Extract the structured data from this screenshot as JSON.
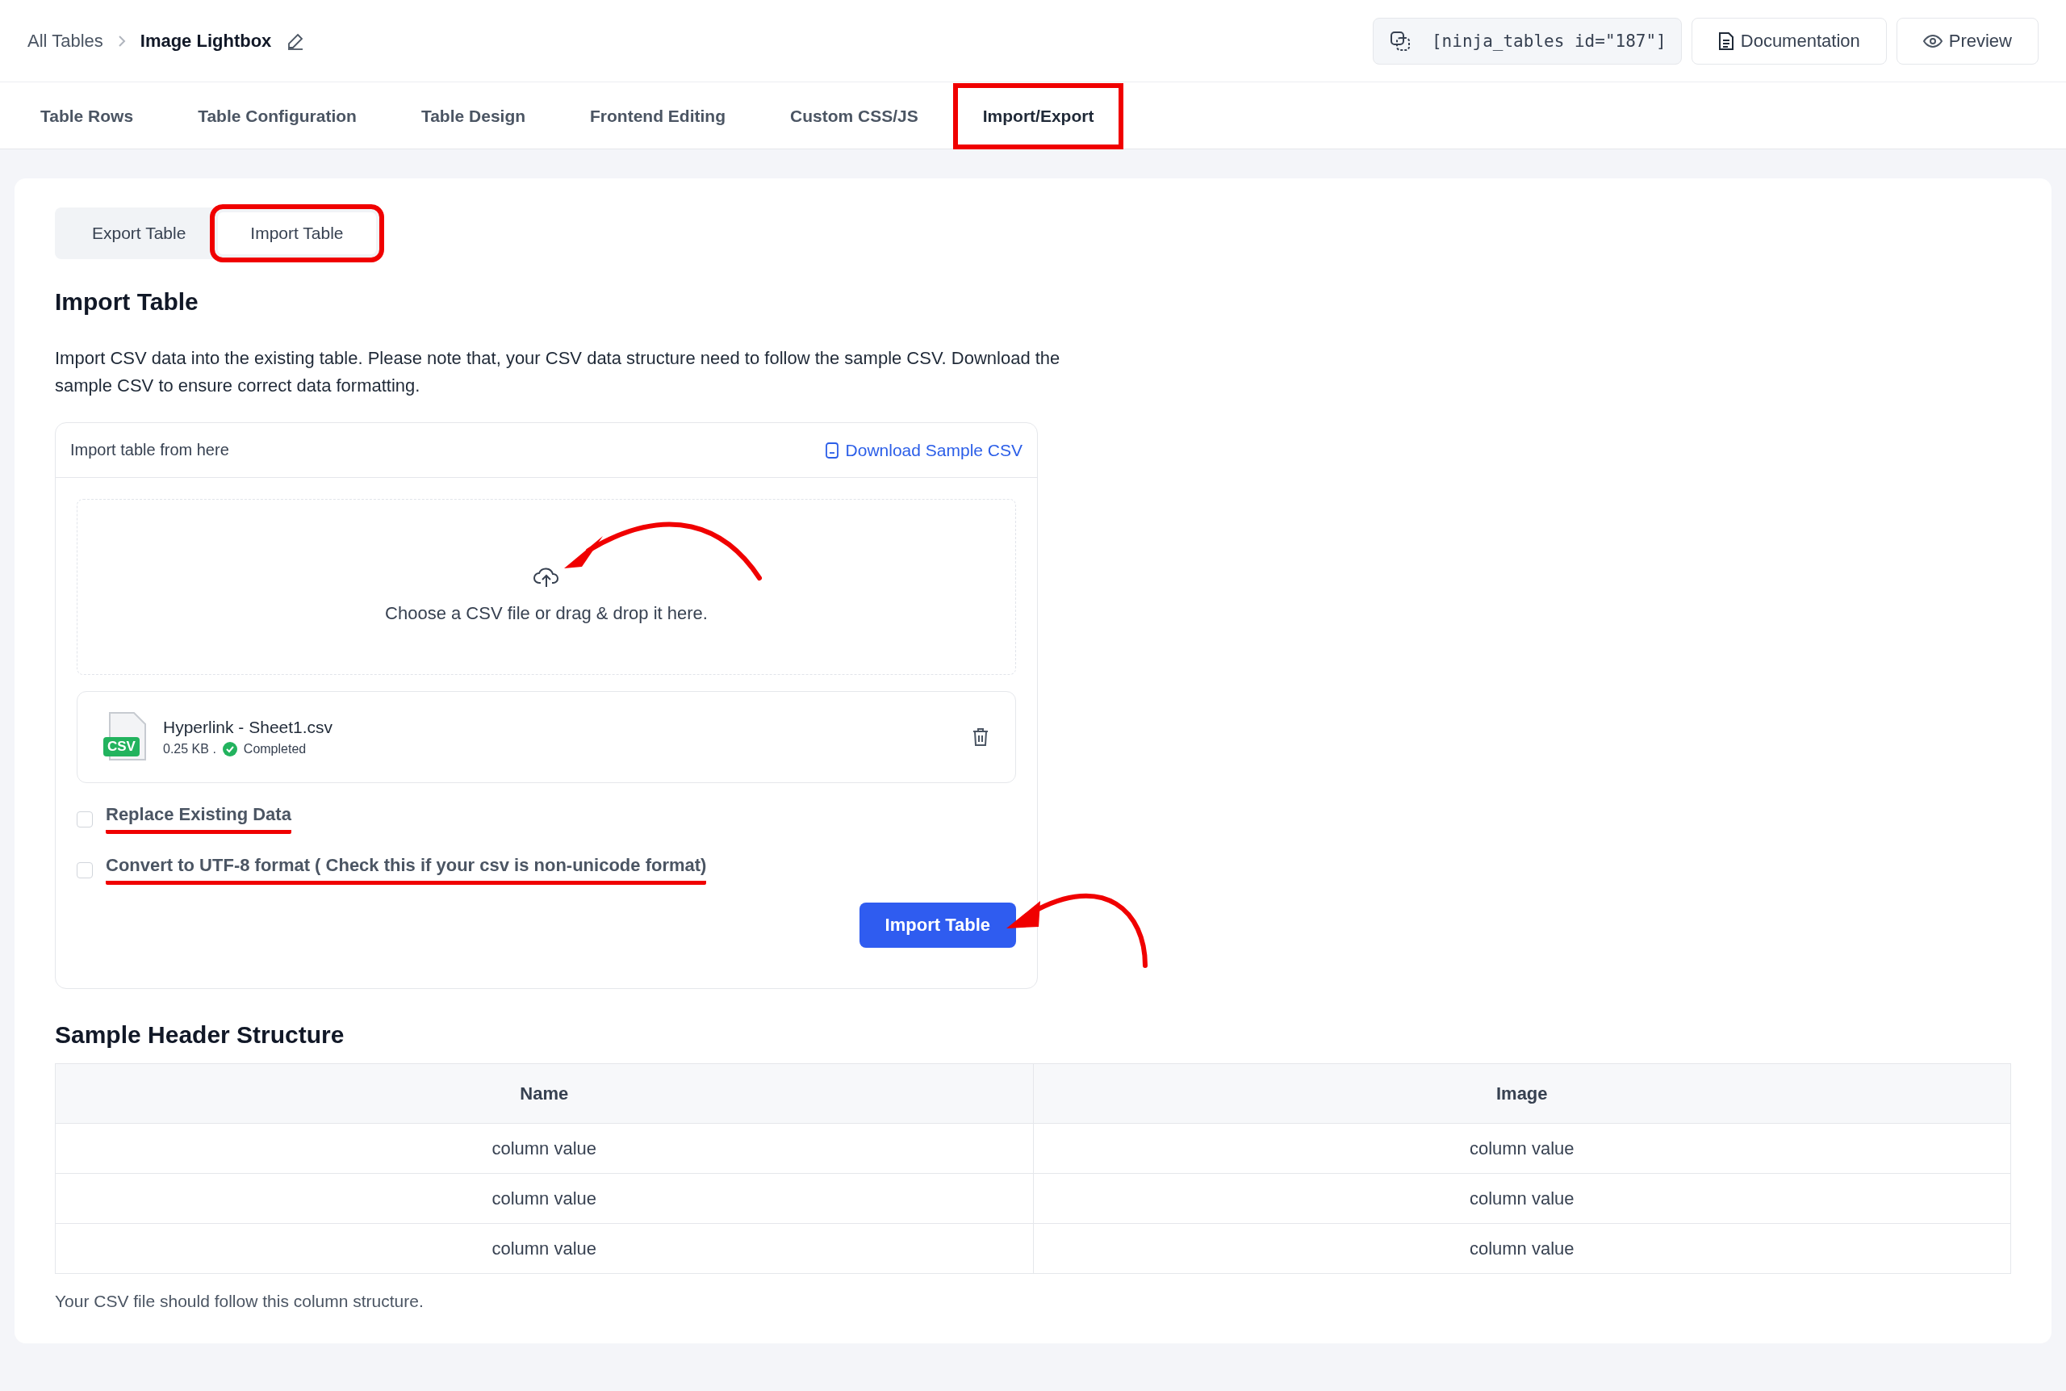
{
  "breadcrumb": {
    "parent": "All Tables",
    "current": "Image Lightbox"
  },
  "header_actions": {
    "shortcode": "[ninja_tables id=\"187\"]",
    "buttons": [
      "Documentation",
      "Preview"
    ]
  },
  "tabs": [
    {
      "label": "Table Rows",
      "selected": false,
      "highlighted": false
    },
    {
      "label": "Table Configuration",
      "selected": false,
      "highlighted": false
    },
    {
      "label": "Table Design",
      "selected": false,
      "highlighted": false
    },
    {
      "label": "Frontend Editing",
      "selected": false,
      "highlighted": false
    },
    {
      "label": "Custom CSS/JS",
      "selected": false,
      "highlighted": false
    },
    {
      "label": "Import/Export",
      "selected": true,
      "highlighted": true
    }
  ],
  "subtabs": [
    {
      "label": "Export Table",
      "selected": false,
      "highlighted": false
    },
    {
      "label": "Import Table",
      "selected": true,
      "highlighted": true
    }
  ],
  "import": {
    "title": "Import Table",
    "description": "Import CSV data into the existing table. Please note that, your CSV data structure need to follow the sample CSV. Download the sample CSV to ensure correct data formatting.",
    "card_title": "Import table from here",
    "download_link": "Download Sample CSV",
    "dropzone_text": "Choose a CSV file or drag & drop it here.",
    "file": {
      "badge": "CSV",
      "name": "Hyperlink - Sheet1.csv",
      "size": "0.25 KB .",
      "status": "Completed"
    },
    "options": [
      {
        "label": "Replace Existing Data",
        "checked": false,
        "underlined": true
      },
      {
        "label": "Convert to UTF-8 format ( Check this if your csv is non-unicode format)",
        "checked": false,
        "underlined": true
      }
    ],
    "submit": "Import Table"
  },
  "sample": {
    "title": "Sample Header Structure",
    "columns": [
      "Name",
      "Image"
    ],
    "rows": [
      [
        "column value",
        "column value"
      ],
      [
        "column value",
        "column value"
      ],
      [
        "column value",
        "column value"
      ]
    ],
    "note": "Your CSV file should follow this column structure."
  }
}
